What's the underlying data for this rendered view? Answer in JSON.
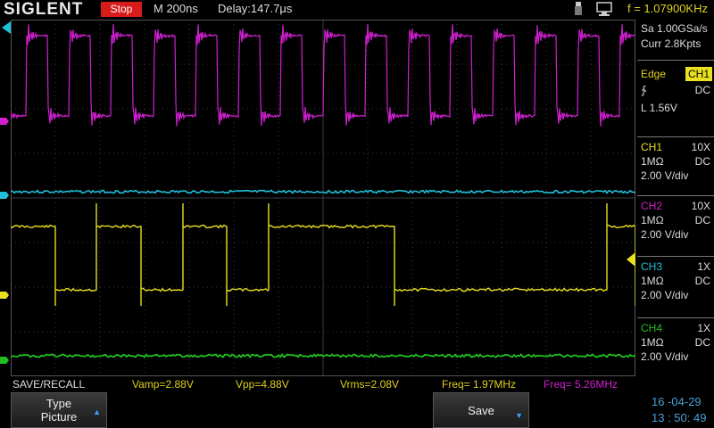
{
  "header": {
    "brand": "SIGLENT",
    "run_state": "Stop",
    "timebase": "M 200ns",
    "delay": "Delay:147.7μs",
    "frequency": "f = 1.07900KHz",
    "icons": [
      "usb-icon",
      "network-printer-icon"
    ]
  },
  "acquisition": {
    "sample_rate": "Sa 1.00GSa/s",
    "memory": "Curr 2.8Kpts"
  },
  "trigger": {
    "type": "Edge",
    "source": "CH1",
    "slope_symbol": "∱",
    "coupling": "DC",
    "level": "L  1.56V"
  },
  "channels": [
    {
      "name": "CH1",
      "probe": "10X",
      "impedance": "1MΩ",
      "coupling": "DC",
      "vdiv": "2.00 V/div",
      "color": "#e8e020"
    },
    {
      "name": "CH2",
      "probe": "10X",
      "impedance": "1MΩ",
      "coupling": "DC",
      "vdiv": "2.00 V/div",
      "color": "#d020d0"
    },
    {
      "name": "CH3",
      "probe": "1X",
      "impedance": "1MΩ",
      "coupling": "DC",
      "vdiv": "2.00 V/div",
      "color": "#20c0d8"
    },
    {
      "name": "CH4",
      "probe": "1X",
      "impedance": "1MΩ",
      "coupling": "DC",
      "vdiv": "2.00 V/div",
      "color": "#20c020"
    }
  ],
  "measurements": {
    "title": "SAVE/RECALL",
    "vamp": "Vamp=2.88V",
    "vpp": "Vpp=4.88V",
    "vrms": "Vrms=2.08V",
    "freq1": "Freq= 1.97MHz",
    "freq2": "Freq= 5.26MHz"
  },
  "menu": {
    "type_label": "Type",
    "type_value": "Picture",
    "save_label": "Save"
  },
  "datetime": {
    "date": "16 -04-29",
    "time": "13 : 50: 49"
  },
  "colors": {
    "grid": "#3a3a3a",
    "ch1": "#e8e020",
    "ch2": "#d020d0",
    "ch3": "#20c0d8",
    "ch4": "#20c020"
  }
}
